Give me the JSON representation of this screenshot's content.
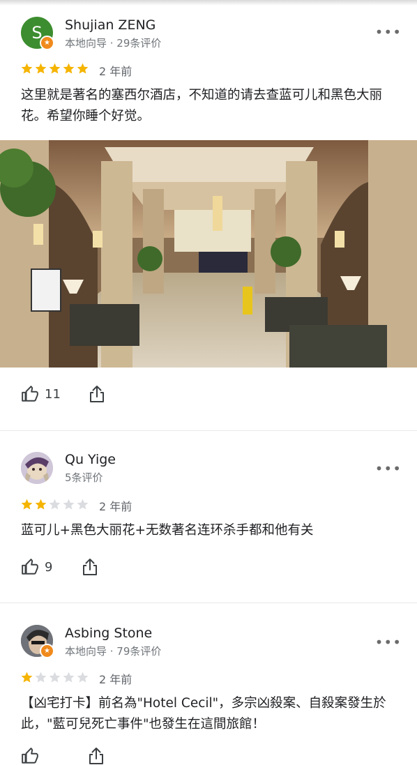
{
  "colors": {
    "star_filled": "#f5b400",
    "star_empty": "#dadce0",
    "badge": "#f08a1c"
  },
  "reviews": [
    {
      "author": "Shujian ZENG",
      "avatar_letter": "S",
      "meta": "本地向导 · 29条评价",
      "rating": 5,
      "time_ago": "2 年前",
      "text": "这里就是著名的塞西尔酒店，不知道的请去查蓝可儿和黑色大丽花。希望你睡个好觉。",
      "likes": "11"
    },
    {
      "author": "Qu Yige",
      "meta": "5条评价",
      "rating": 2,
      "time_ago": "2 年前",
      "text": "蓝可儿+黑色大丽花+无数著名连环杀手都和他有关",
      "likes": "9"
    },
    {
      "author": "Asbing Stone",
      "meta": "本地向导 · 79条评价",
      "rating": 1,
      "time_ago": "2 年前",
      "text": "【凶宅打卡】前名為\"Hotel Cecil\"，多宗凶殺案、自殺案發生於此，\"藍可兒死亡事件\"也發生在這間旅館！"
    }
  ],
  "icons": {
    "more": "more-options-icon",
    "like": "thumbs-up-icon",
    "share": "share-icon",
    "local_guide": "local-guide-star-icon"
  }
}
